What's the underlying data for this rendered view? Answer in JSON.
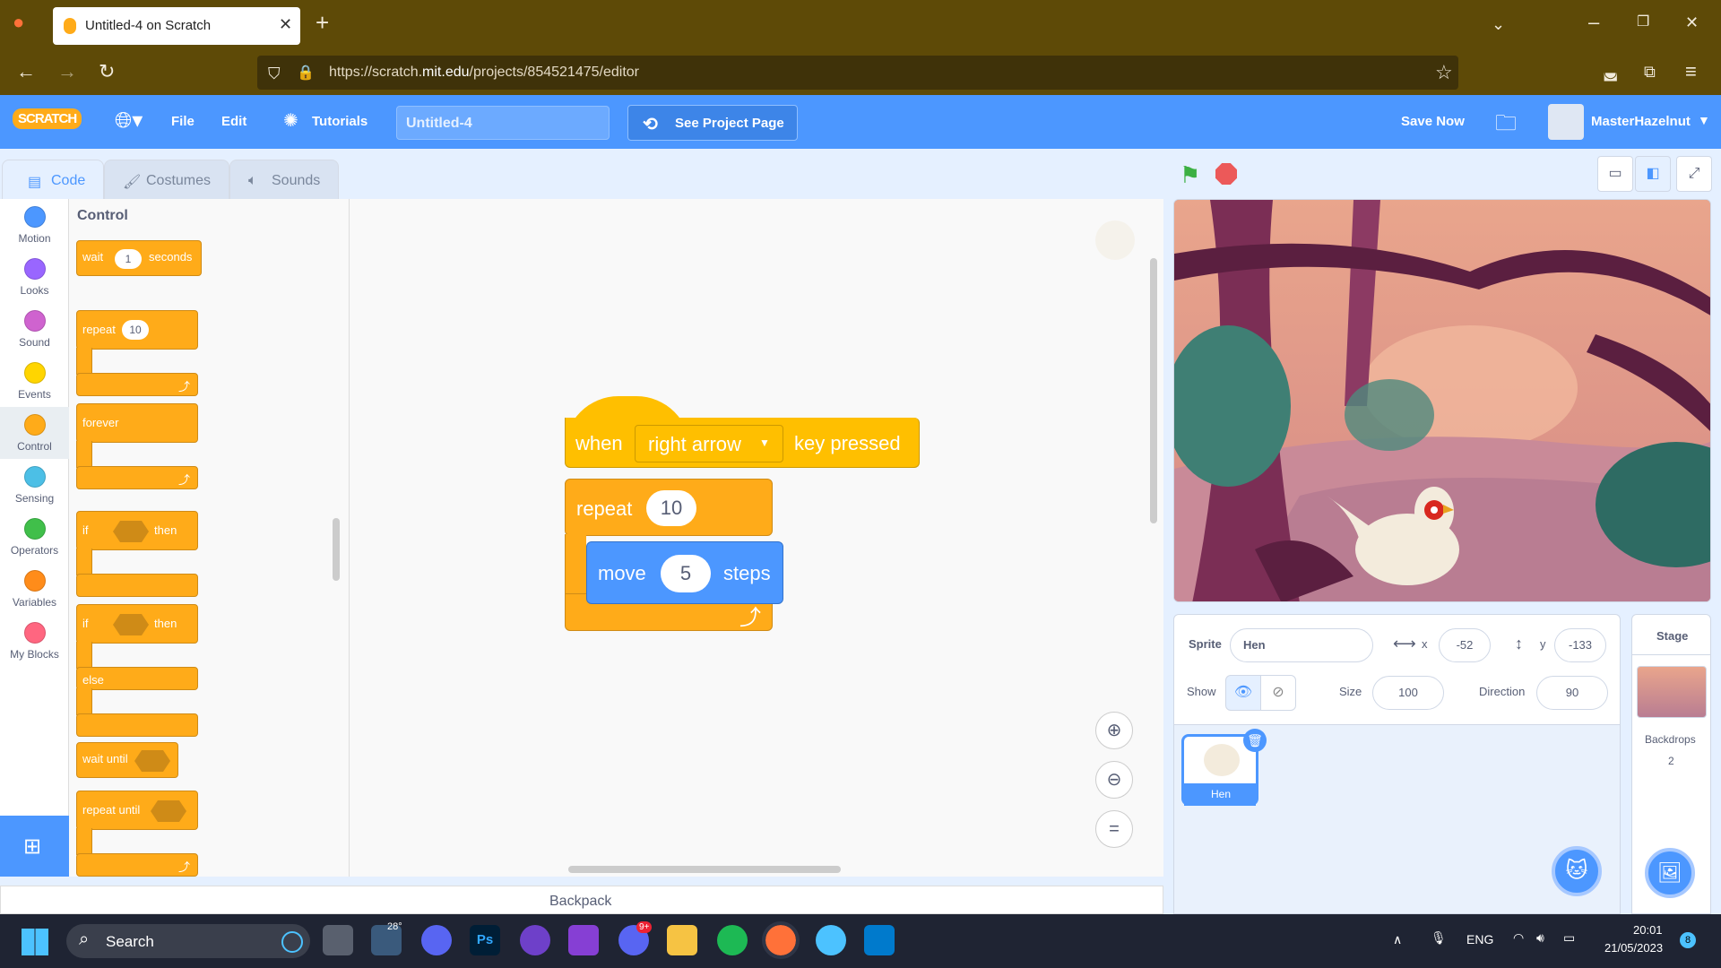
{
  "browser": {
    "tab_title": "Untitled-4 on Scratch",
    "url_prefix": "https://scratch.",
    "url_domain": "mit.edu",
    "url_suffix": "/projects/854521475/editor"
  },
  "menu": {
    "logo": "SCRATCH",
    "file": "File",
    "edit": "Edit",
    "tutorials": "Tutorials",
    "project_title": "Untitled-4",
    "see_project": "See Project Page",
    "save_now": "Save Now",
    "username": "MasterHazelnut"
  },
  "tabs": {
    "code": "Code",
    "costumes": "Costumes",
    "sounds": "Sounds"
  },
  "categories": [
    {
      "label": "Motion",
      "color": "#4c97ff"
    },
    {
      "label": "Looks",
      "color": "#9966ff"
    },
    {
      "label": "Sound",
      "color": "#cf63cf"
    },
    {
      "label": "Events",
      "color": "#ffd500"
    },
    {
      "label": "Control",
      "color": "#ffab19"
    },
    {
      "label": "Sensing",
      "color": "#4cbfe6"
    },
    {
      "label": "Operators",
      "color": "#40bf4a"
    },
    {
      "label": "Variables",
      "color": "#ff8c1a"
    },
    {
      "label": "My Blocks",
      "color": "#ff6680"
    }
  ],
  "palette": {
    "heading": "Control",
    "wait": "wait",
    "wait_val": "1",
    "seconds": "seconds",
    "repeat": "repeat",
    "repeat_val": "10",
    "forever": "forever",
    "if": "if",
    "then": "then",
    "else": "else",
    "wait_until": "wait until",
    "repeat_until": "repeat until"
  },
  "script": {
    "when": "when",
    "key": "right arrow",
    "key_pressed": "key pressed",
    "repeat": "repeat",
    "repeat_val": "10",
    "move": "move",
    "move_val": "5",
    "steps": "steps"
  },
  "backpack": "Backpack",
  "sprite": {
    "label": "Sprite",
    "name": "Hen",
    "x_label": "x",
    "x": "-52",
    "y_label": "y",
    "y": "-133",
    "show": "Show",
    "size_label": "Size",
    "size": "100",
    "direction_label": "Direction",
    "direction": "90",
    "thumb_name": "Hen"
  },
  "stage_panel": {
    "title": "Stage",
    "backdrops_label": "Backdrops",
    "backdrops_count": "2"
  },
  "taskbar": {
    "search": "Search",
    "weather": "28°",
    "discord_badge": "9+",
    "lang": "ENG",
    "time": "20:01",
    "date": "21/05/2023",
    "notif": "8"
  },
  "colors": {
    "scratch_blue": "#4c97ff",
    "control": "#ffab19",
    "events": "#ffbf00",
    "motion": "#4c97ff"
  }
}
